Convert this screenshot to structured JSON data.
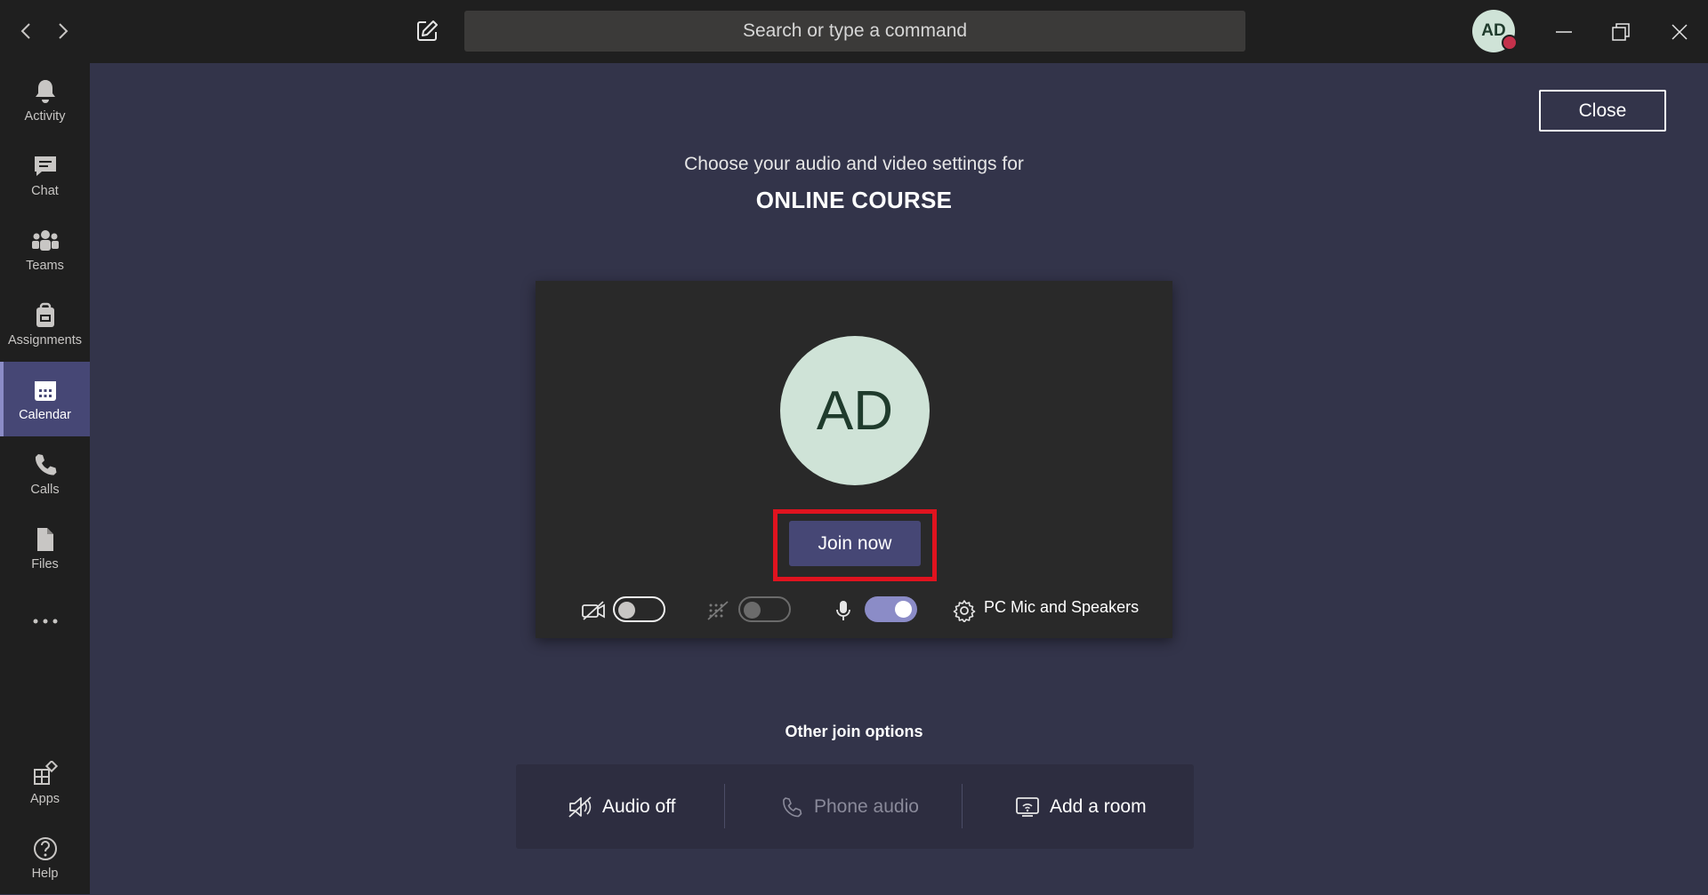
{
  "titlebar": {
    "search_placeholder": "Search or type a command",
    "user_initials": "AD"
  },
  "rail": {
    "items": [
      {
        "label": "Activity",
        "icon": "bell-icon"
      },
      {
        "label": "Chat",
        "icon": "chat-icon"
      },
      {
        "label": "Teams",
        "icon": "teams-icon"
      },
      {
        "label": "Assignments",
        "icon": "assignments-icon"
      },
      {
        "label": "Calendar",
        "icon": "calendar-icon",
        "active": true
      },
      {
        "label": "Calls",
        "icon": "phone-icon"
      },
      {
        "label": "Files",
        "icon": "files-icon"
      }
    ],
    "bottom": [
      {
        "label": "Apps",
        "icon": "apps-icon"
      },
      {
        "label": "Help",
        "icon": "help-icon"
      }
    ]
  },
  "main": {
    "close_label": "Close",
    "subtitle": "Choose your audio and video settings for",
    "meeting_title": "ONLINE COURSE",
    "avatar_initials": "AD",
    "join_label": "Join now",
    "camera_on": false,
    "blur_on": false,
    "mic_on": true,
    "device_label": "PC Mic and Speakers",
    "other_title": "Other join options",
    "options": [
      {
        "label": "Audio off",
        "icon": "speaker-off-icon"
      },
      {
        "label": "Phone audio",
        "icon": "phone-icon"
      },
      {
        "label": "Add a room",
        "icon": "cast-icon"
      }
    ]
  },
  "colors": {
    "accent": "#464775",
    "toggle_on": "#8b8cc7",
    "highlight": "#e0131f",
    "avatar_bg": "#cfe3d7",
    "status_busy": "#c4314b"
  }
}
